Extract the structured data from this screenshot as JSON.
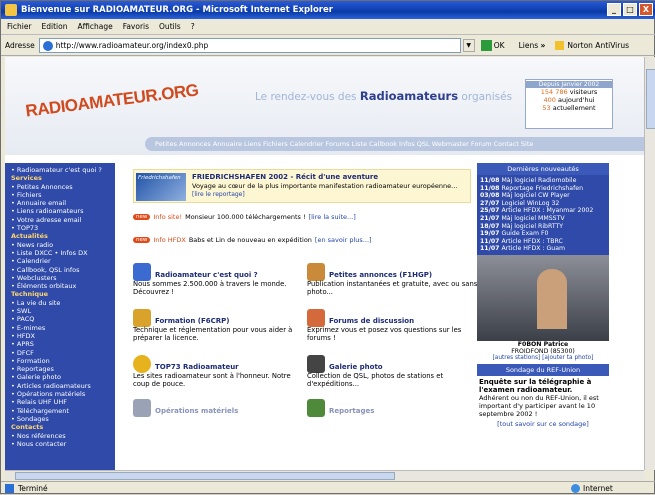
{
  "window": {
    "title": "Bienvenue sur RADIOAMATEUR.ORG - Microsoft Internet Explorer",
    "minimize": "_",
    "maximize": "□",
    "close": "X"
  },
  "menu": [
    "Fichier",
    "Edition",
    "Affichage",
    "Favoris",
    "Outils",
    "?"
  ],
  "address": {
    "label": "Adresse",
    "url": "http://www.radioamateur.org/index0.php",
    "go": "OK",
    "links": "Liens",
    "chevron": "»",
    "norton": "Norton AntiVirus"
  },
  "header": {
    "logo": "RADIOAMATEUR.ORG",
    "tag_pre": "Le rendez-vous des",
    "tag_bold": "Radioamateurs",
    "tag_post": "organisés",
    "stats": {
      "head": "Depuis Janvier 2002",
      "visitors_n": "154 786",
      "visitors": "visiteurs",
      "today_n": "400",
      "today": "aujourd'hui",
      "now_n": "53",
      "now": "actuellement"
    },
    "nav": "Petites Annonces  Annuaire Liens  Fichiers  Calendrier  Forums  Liste Callbook  Infos QSL  Webmaster  Forum  Contact  Site"
  },
  "sidebar": [
    {
      "t": "• Radioamateur c'est quoi ?",
      "s": false
    },
    {
      "t": "Services",
      "s": true
    },
    {
      "t": "• Petites Annonces",
      "s": false
    },
    {
      "t": "• Fichiers",
      "s": false
    },
    {
      "t": "• Annuaire email",
      "s": false
    },
    {
      "t": "• Liens radioamateurs",
      "s": false
    },
    {
      "t": "• Votre adresse email",
      "s": false
    },
    {
      "t": "• TOP73",
      "s": false
    },
    {
      "t": "Actualités",
      "s": true
    },
    {
      "t": "• News radio",
      "s": false
    },
    {
      "t": "• Liste DXCC • Infos DX",
      "s": false
    },
    {
      "t": "• Calendrier",
      "s": false
    },
    {
      "t": "• Callbook, QSL infos",
      "s": false
    },
    {
      "t": "• Webclusters",
      "s": false
    },
    {
      "t": "• Éléments orbitaux",
      "s": false
    },
    {
      "t": "Technique",
      "s": true
    },
    {
      "t": "• La vie du site",
      "s": false
    },
    {
      "t": "• SWL",
      "s": false
    },
    {
      "t": "• PACQ",
      "s": false
    },
    {
      "t": "• E-mimes",
      "s": false
    },
    {
      "t": "• HFDX",
      "s": false
    },
    {
      "t": "• APRS",
      "s": false
    },
    {
      "t": "• DFCF",
      "s": false
    },
    {
      "t": "• Formation",
      "s": false
    },
    {
      "t": "• Reportages",
      "s": false
    },
    {
      "t": "• Galerie photo",
      "s": false
    },
    {
      "t": "• Articles radioamateurs",
      "s": false
    },
    {
      "t": "• Opérations matériels",
      "s": false
    },
    {
      "t": "• Relais UHF UHF",
      "s": false
    },
    {
      "t": "• Téléchargement",
      "s": false
    },
    {
      "t": "• Sondages",
      "s": false
    },
    {
      "t": "Contacts",
      "s": true
    },
    {
      "t": "• Nos références",
      "s": false
    },
    {
      "t": "• Nous contacter",
      "s": false
    }
  ],
  "feature": {
    "img": "Friedrichshafen",
    "title": "FRIEDRICHSHAFEN 2002 - Récit d'une aventure",
    "desc": "Voyage au cœur de la plus importante manifestation radioamateur européenne...",
    "more": "[lire le reportage]"
  },
  "news": [
    {
      "tag": "new",
      "src": "Info site!",
      "text": "Monsieur 100.000 téléchargements !",
      "lnk": "[lire la suite...]"
    },
    {
      "tag": "new",
      "src": "Info HFDX",
      "text": "Babs et Lin de nouveau en expédition",
      "lnk": "[en savoir plus...]"
    }
  ],
  "cards": [
    {
      "t": "Radioamateur c'est quoi ?",
      "d": "Nous sommes 2.500.000 à travers le monde. Découvrez !"
    },
    {
      "t": "Petites annonces (F1HGP)",
      "d": "Publication instantanées et gratuite, avec ou sans photo..."
    },
    {
      "t": "Formation (F6CRP)",
      "d": "Technique et réglementation pour vous aider à préparer la licence."
    },
    {
      "t": "Forums de discussion",
      "d": "Exprimez vous et posez vos questions sur les forums !"
    },
    {
      "t": "TOP73 Radioamateur",
      "d": "Les sites radioamateur sont à l'honneur. Notre coup de pouce."
    },
    {
      "t": "Galerie photo",
      "d": "Collection de QSL, photos de stations et d'expéditions..."
    },
    {
      "t": "Opérations matériels",
      "d": ""
    },
    {
      "t": "Reportages",
      "d": ""
    }
  ],
  "right": {
    "head": "Dernières nouveautés",
    "items": [
      {
        "d": "11/08",
        "t": "Màj logiciel Radiomobile"
      },
      {
        "d": "11/08",
        "t": "Reportage Friedrichshafen"
      },
      {
        "d": "03/08",
        "t": "Màj logiciel CW Player"
      },
      {
        "d": "27/07",
        "t": "Logiciel WinLog 32"
      },
      {
        "d": "25/07",
        "t": "Article HFDX : Myanmar 2002"
      },
      {
        "d": "21/07",
        "t": "Màj logiciel MMSSTV"
      },
      {
        "d": "18/07",
        "t": "Màj logiciel RibRTTY"
      },
      {
        "d": "19/07",
        "t": "Guide Exam F0"
      },
      {
        "d": "11/07",
        "t": "Article HFDX : TBRC"
      },
      {
        "d": "11/07",
        "t": "Article HFDX : Guam"
      }
    ],
    "caption_call": "F0BON",
    "caption_name": "Patrice",
    "caption_loc": "FROIDFOND (85300)",
    "caption_links": "[autres stations] [ajouter ta photo]",
    "poll_head": "Sondage du REF-Union",
    "poll_title": "Enquête sur la télégraphie à l'examen radioamateur.",
    "poll_text": "Adhérent ou non du REF-Union, il est important d'y participer avant le 10 septembre 2002 !",
    "poll_link": "[tout savoir sur ce sondage]"
  },
  "status": {
    "text": "Terminé",
    "zone": "Internet"
  }
}
